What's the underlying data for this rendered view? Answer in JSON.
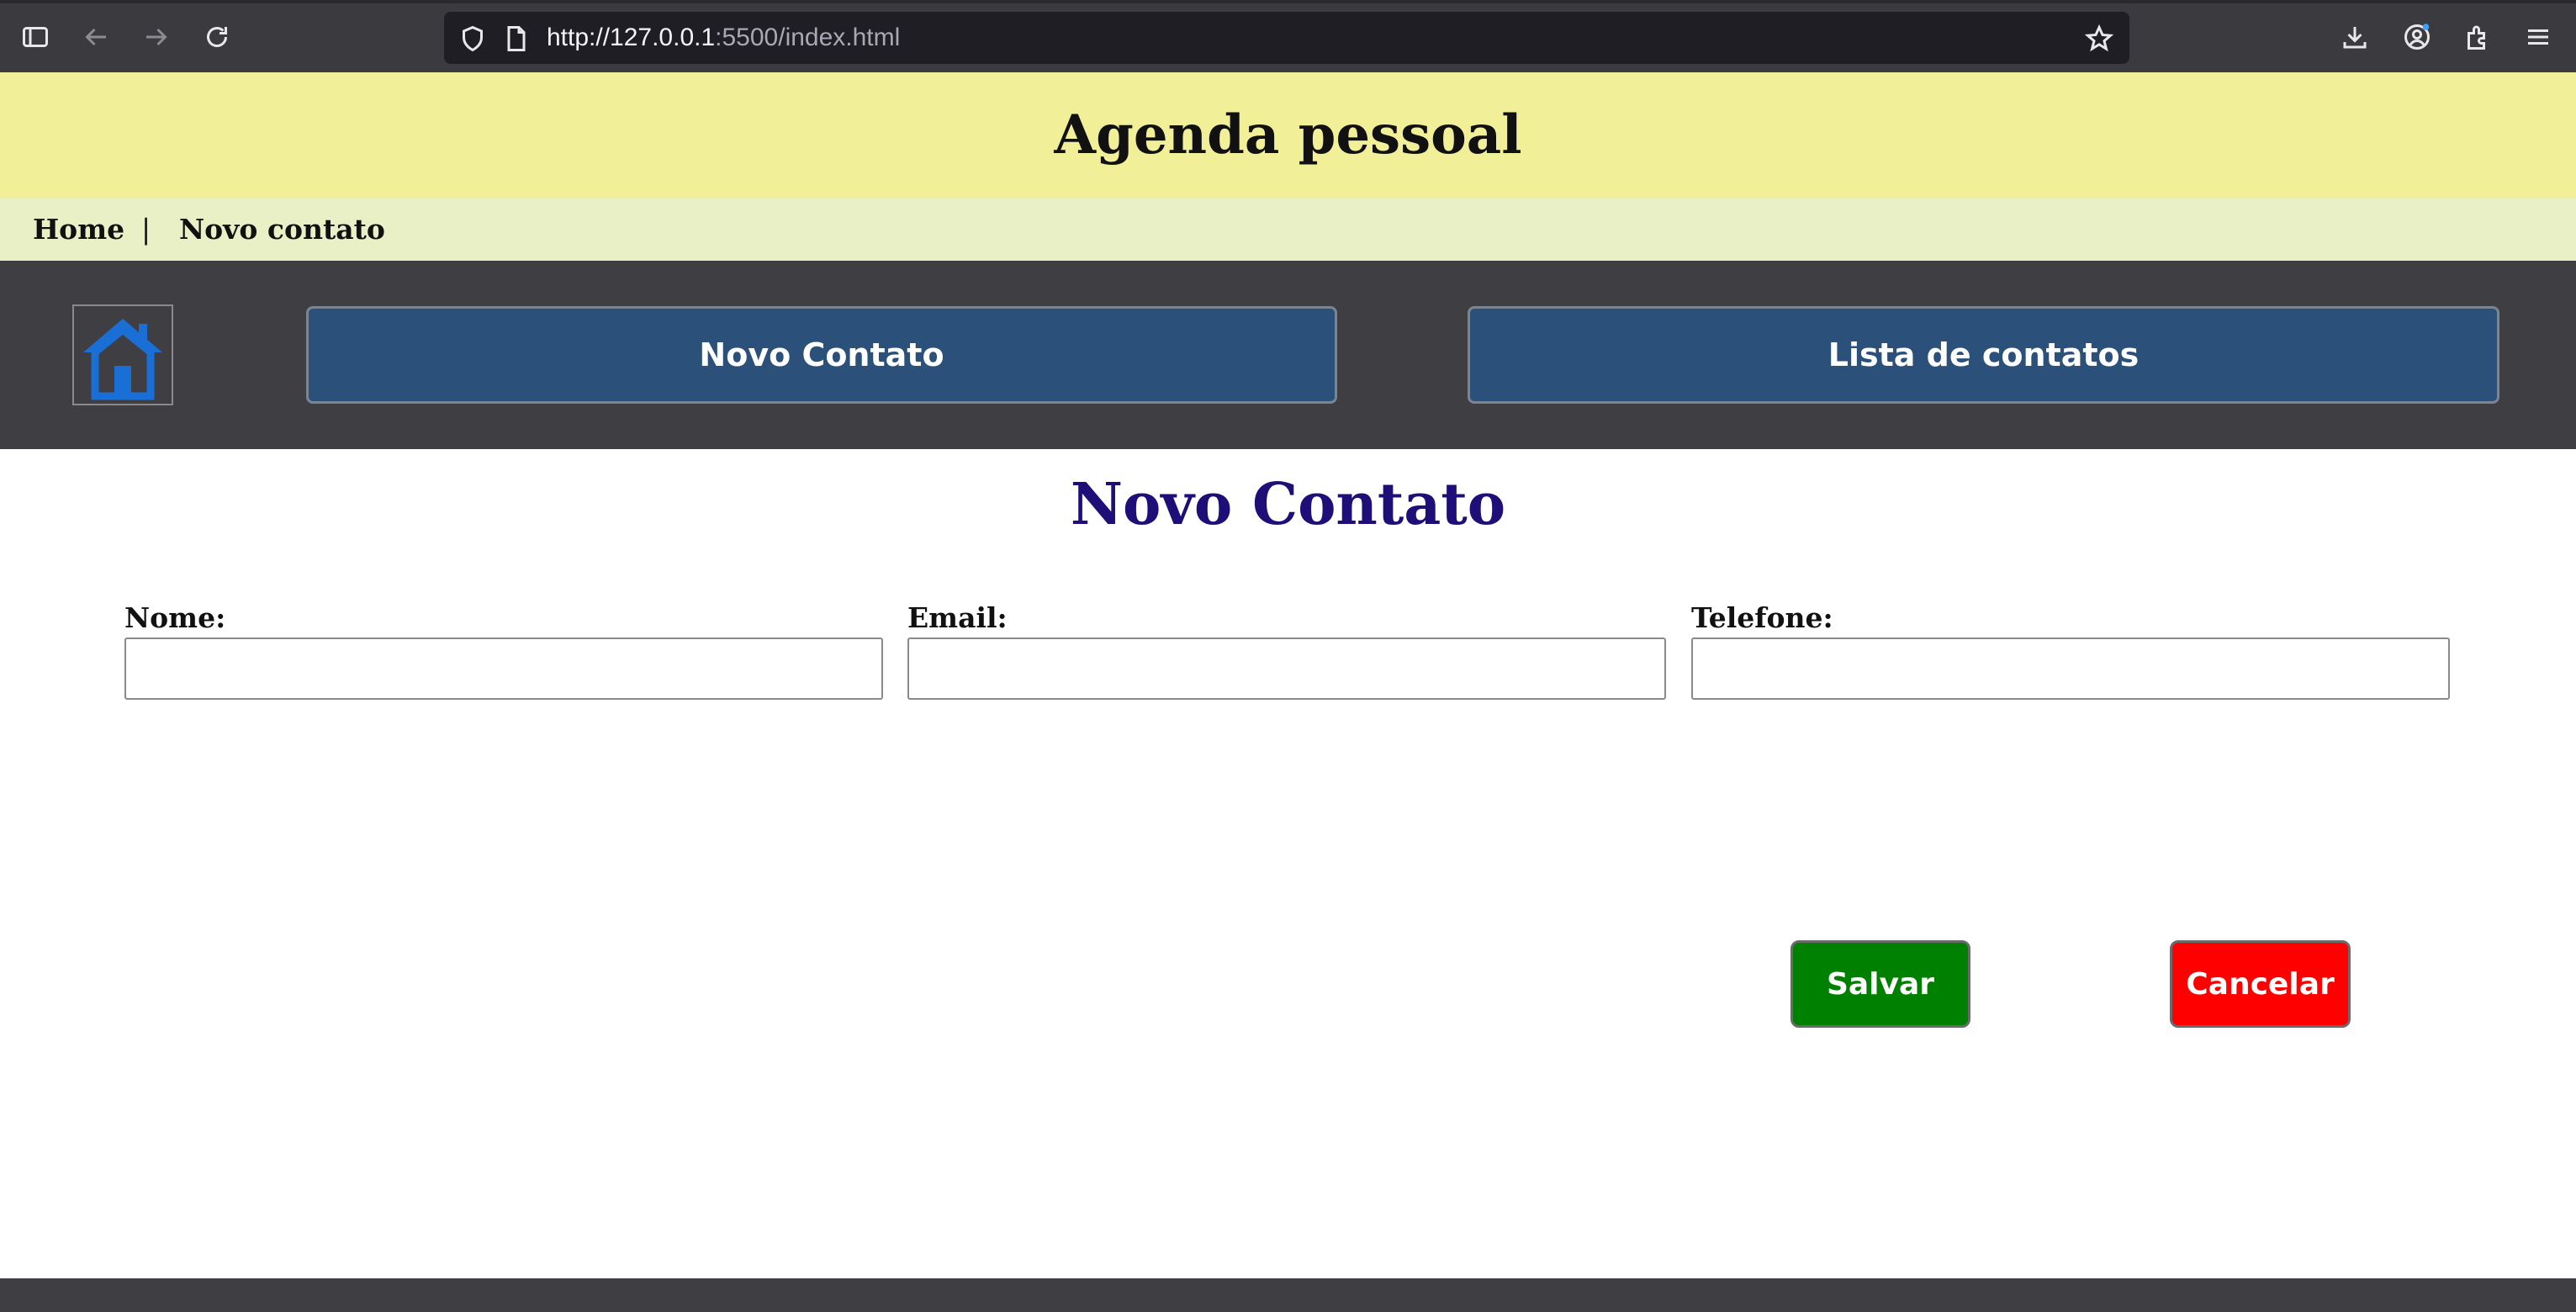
{
  "browser": {
    "url_host": "http://127.0.0.1",
    "url_rest": ":5500/index.html"
  },
  "header": {
    "title": "Agenda pessoal"
  },
  "breadcrumb": {
    "home": "Home",
    "separator": "|",
    "current": "Novo contato"
  },
  "nav": {
    "new_contact": "Novo Contato",
    "contact_list": "Lista de contatos"
  },
  "form": {
    "title": "Novo Contato",
    "name_label": "Nome:",
    "email_label": "Email:",
    "phone_label": "Telefone:",
    "name_value": "",
    "email_value": "",
    "phone_value": "",
    "save_label": "Salvar",
    "cancel_label": "Cancelar"
  },
  "colors": {
    "header_bg": "#f2ef99",
    "breadcrumb_bg": "#e9f0c6",
    "nav_bg": "#3f3f43",
    "nav_button": "#2b507a",
    "title_color": "#1e0f78",
    "save_button": "#008000",
    "cancel_button": "#ff0000",
    "home_icon": "#1a6fd6"
  }
}
